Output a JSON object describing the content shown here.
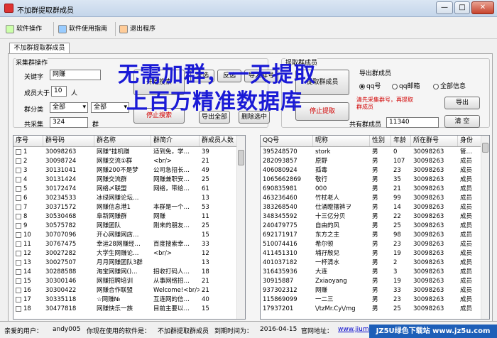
{
  "window": {
    "title": "不加群提取群成员",
    "min": "—",
    "max": "□",
    "close": "✕"
  },
  "menu": {
    "items": [
      {
        "label": "软件操作",
        "icon": "gear-icon"
      },
      {
        "label": "软件使用指南",
        "icon": "help-icon"
      },
      {
        "label": "退出程序",
        "icon": "exit-icon"
      }
    ]
  },
  "tab": {
    "label": "不加群提取群成员"
  },
  "left_panel": {
    "group_title": "采集群操作",
    "keyword_label": "关键字",
    "keyword_value": "网赚",
    "members_gt_label": "成员大于",
    "members_gt_value": "10",
    "members_unit": "人",
    "category_label": "群分类",
    "category_value": "全部",
    "subcategory_value": "全部",
    "total_label": "共采集",
    "total_value": "324",
    "total_unit": "群",
    "start_search_btn": "开始搜索",
    "stop_search_btn": "停止搜索",
    "btn_select_all": "全选",
    "btn_invert": "反选",
    "btn_import": "导入群号",
    "btn_export_all": "导出全部",
    "btn_delete_selected": "删除选中"
  },
  "right_panel": {
    "group_title": "提取群成员",
    "extract_btn": "提取群成员",
    "stop_extract_btn": "停止提取",
    "export_type_label": "导出群成员",
    "radio_qq": "qq号",
    "radio_mail": "qq邮箱",
    "radio_all": "全部信息",
    "red_note": "清先采集群号，再提取群成员",
    "total_label": "共有群成员",
    "total_value": "11340",
    "export_btn": "导出",
    "clear_btn": "清 空"
  },
  "overlay": {
    "line1": "无需加群，一天提取",
    "line2": "上百万精准数据库"
  },
  "left_table": {
    "headers": [
      "序号",
      "群号码",
      "群名称",
      "群简介",
      "群成员人数"
    ],
    "rows": [
      [
        "1",
        "30098263",
        "网赚\"挂机赚",
        "适到免，学…",
        "39"
      ],
      [
        "2",
        "30098724",
        "网赚交流①群",
        "<br/>",
        "21"
      ],
      [
        "3",
        "30131041",
        "网赚200不是梦",
        "公司急招长…",
        "49"
      ],
      [
        "4",
        "30131424",
        "网赚交流群",
        "网赚兼职安…",
        "25"
      ],
      [
        "5",
        "30172474",
        "网络〆联盟",
        "网络，带给…",
        "61"
      ],
      [
        "6",
        "30234533",
        "冰绿网赚论坛…",
        "",
        "13"
      ],
      [
        "7",
        "30371572",
        "网赚信息港1",
        "本群是一个…",
        "53"
      ],
      [
        "8",
        "30530468",
        "阜新网赚群",
        "网赚",
        "11"
      ],
      [
        "9",
        "30575782",
        "网赚团队",
        "刚来的朋友…",
        "25"
      ],
      [
        "10",
        "30707096",
        "开心网赚网店…",
        "",
        "15"
      ],
      [
        "11",
        "30767475",
        "幸运28网赚经…",
        "百度搜索幸…",
        "33"
      ],
      [
        "12",
        "30027282",
        "大学生网赚论…",
        "<br/>",
        "12"
      ],
      [
        "13",
        "30027507",
        "月月网赚团队3群",
        "",
        "13"
      ],
      [
        "14",
        "30288588",
        "淘宝网赚网()…",
        "招收打码人…",
        "18"
      ],
      [
        "15",
        "30300146",
        "网赚招聘培训",
        "从事网络招…",
        "21"
      ],
      [
        "16",
        "30300422",
        "网赚合作联盟",
        "Welcome!<br/>",
        "21"
      ],
      [
        "17",
        "30335118",
        "☆网赚№",
        "互连网的信…",
        "40"
      ],
      [
        "18",
        "30477818",
        "网赚快乐一族",
        "目前主要以…",
        "15"
      ]
    ]
  },
  "right_table": {
    "headers": [
      "QQ号",
      "昵称",
      "性别",
      "年龄",
      "所在群号",
      "身份"
    ],
    "rows": [
      [
        "395248570",
        "stork",
        "男",
        "0",
        "30098263",
        "管…"
      ],
      [
        "282093857",
        "原野",
        "男",
        "107",
        "30098263",
        "成员"
      ],
      [
        "406080924",
        "孤毒",
        "男",
        "23",
        "30098263",
        "成员"
      ],
      [
        "1065662869",
        "敬行",
        "男",
        "35",
        "30098263",
        "成员"
      ],
      [
        "690835981",
        "000",
        "男",
        "21",
        "30098263",
        "成员"
      ],
      [
        "463236460",
        "竹杖老人",
        "男",
        "99",
        "30098263",
        "成员"
      ],
      [
        "383268540",
        "仕涌瞪摆裤ヲ",
        "男",
        "14",
        "30098263",
        "成员"
      ],
      [
        "348345592",
        "十三亿分贝",
        "男",
        "22",
        "30098263",
        "成员"
      ],
      [
        "240479775",
        "自由的风",
        "男",
        "25",
        "30098263",
        "成员"
      ],
      [
        "692171917",
        "东方之主",
        "男",
        "98",
        "30098263",
        "成员"
      ],
      [
        "510074416",
        "希尔顿",
        "男",
        "23",
        "30098263",
        "成员"
      ],
      [
        "411451310",
        "埔孖殷兒",
        "男",
        "19",
        "30098263",
        "成员"
      ],
      [
        "401037182",
        "一杯清水",
        "男",
        "2",
        "30098263",
        "成员"
      ],
      [
        "316435936",
        "大连",
        "男",
        "3",
        "30098263",
        "成员"
      ],
      [
        "30915887",
        "Zxiaoyang",
        "男",
        "19",
        "30098263",
        "成员"
      ],
      [
        "937302312",
        "网赚",
        "男",
        "33",
        "30098263",
        "成员"
      ],
      [
        "115869099",
        "一二三",
        "男",
        "23",
        "30098263",
        "成员"
      ],
      [
        "17937201",
        "\\/tzMr.Cy\\/mg",
        "男",
        "25",
        "30098263",
        "成员"
      ]
    ]
  },
  "status": {
    "user_label": "亲爱的用户：",
    "user_value": "andy005",
    "software_label": "你现在使用的软件是：",
    "software_value": "不加群提取群成员",
    "expire_label": "到期时间为：",
    "expire_value": "2016-04-15",
    "site_label": "官网地址：",
    "site_value": "www.jium…"
  },
  "watermark": {
    "text": "JZ5U绿色下载站 www.jz5u.com"
  }
}
